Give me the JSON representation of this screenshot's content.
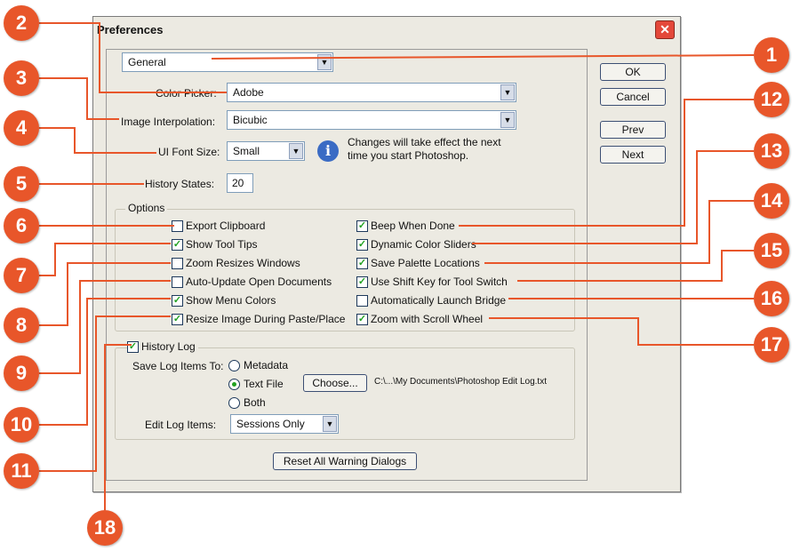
{
  "dialog": {
    "title": "Preferences",
    "close_symbol": "✕",
    "section": "General",
    "color_picker": {
      "label": "Color Picker:",
      "value": "Adobe"
    },
    "interpolation": {
      "label": "Image Interpolation:",
      "value": "Bicubic"
    },
    "font_size": {
      "label": "UI Font Size:",
      "value": "Small"
    },
    "info_text_1": "Changes will take effect the next",
    "info_text_2": "time you start Photoshop.",
    "history_states": {
      "label": "History States:",
      "value": "20"
    },
    "buttons": {
      "ok": "OK",
      "cancel": "Cancel",
      "prev": "Prev",
      "next": "Next"
    },
    "options": {
      "label": "Options",
      "left": [
        {
          "label": "Export Clipboard",
          "checked": false
        },
        {
          "label": "Show Tool Tips",
          "checked": true
        },
        {
          "label": "Zoom Resizes Windows",
          "checked": false
        },
        {
          "label": "Auto-Update Open Documents",
          "checked": false
        },
        {
          "label": "Show Menu Colors",
          "checked": true
        },
        {
          "label": "Resize Image During Paste/Place",
          "checked": true
        }
      ],
      "right": [
        {
          "label": "Beep When Done",
          "checked": true
        },
        {
          "label": "Dynamic Color Sliders",
          "checked": true
        },
        {
          "label": "Save Palette Locations",
          "checked": true
        },
        {
          "label": "Use Shift Key for Tool Switch",
          "checked": true
        },
        {
          "label": "Automatically Launch Bridge",
          "checked": false
        },
        {
          "label": "Zoom with Scroll Wheel",
          "checked": true
        }
      ]
    },
    "history_log": {
      "label": "History Log",
      "checked": true,
      "save_label": "Save Log Items To:",
      "radio_metadata": "Metadata",
      "radio_textfile": "Text File",
      "radio_both": "Both",
      "selected": "Text File",
      "choose": "Choose...",
      "path": "C:\\...\\My Documents\\Photoshop Edit Log.txt",
      "edit_label": "Edit Log Items:",
      "edit_value": "Sessions Only"
    },
    "reset_button": "Reset All Warning Dialogs"
  },
  "callouts": [
    "1",
    "2",
    "3",
    "4",
    "5",
    "6",
    "7",
    "8",
    "9",
    "10",
    "11",
    "12",
    "13",
    "14",
    "15",
    "16",
    "17",
    "18"
  ],
  "colors": {
    "callout": "#e8562a",
    "dialog_bg": "#eceae2",
    "check": "#21a121"
  },
  "icons": {
    "info": "info-icon",
    "dropdown": "chevron-down-icon",
    "close": "close-icon"
  }
}
